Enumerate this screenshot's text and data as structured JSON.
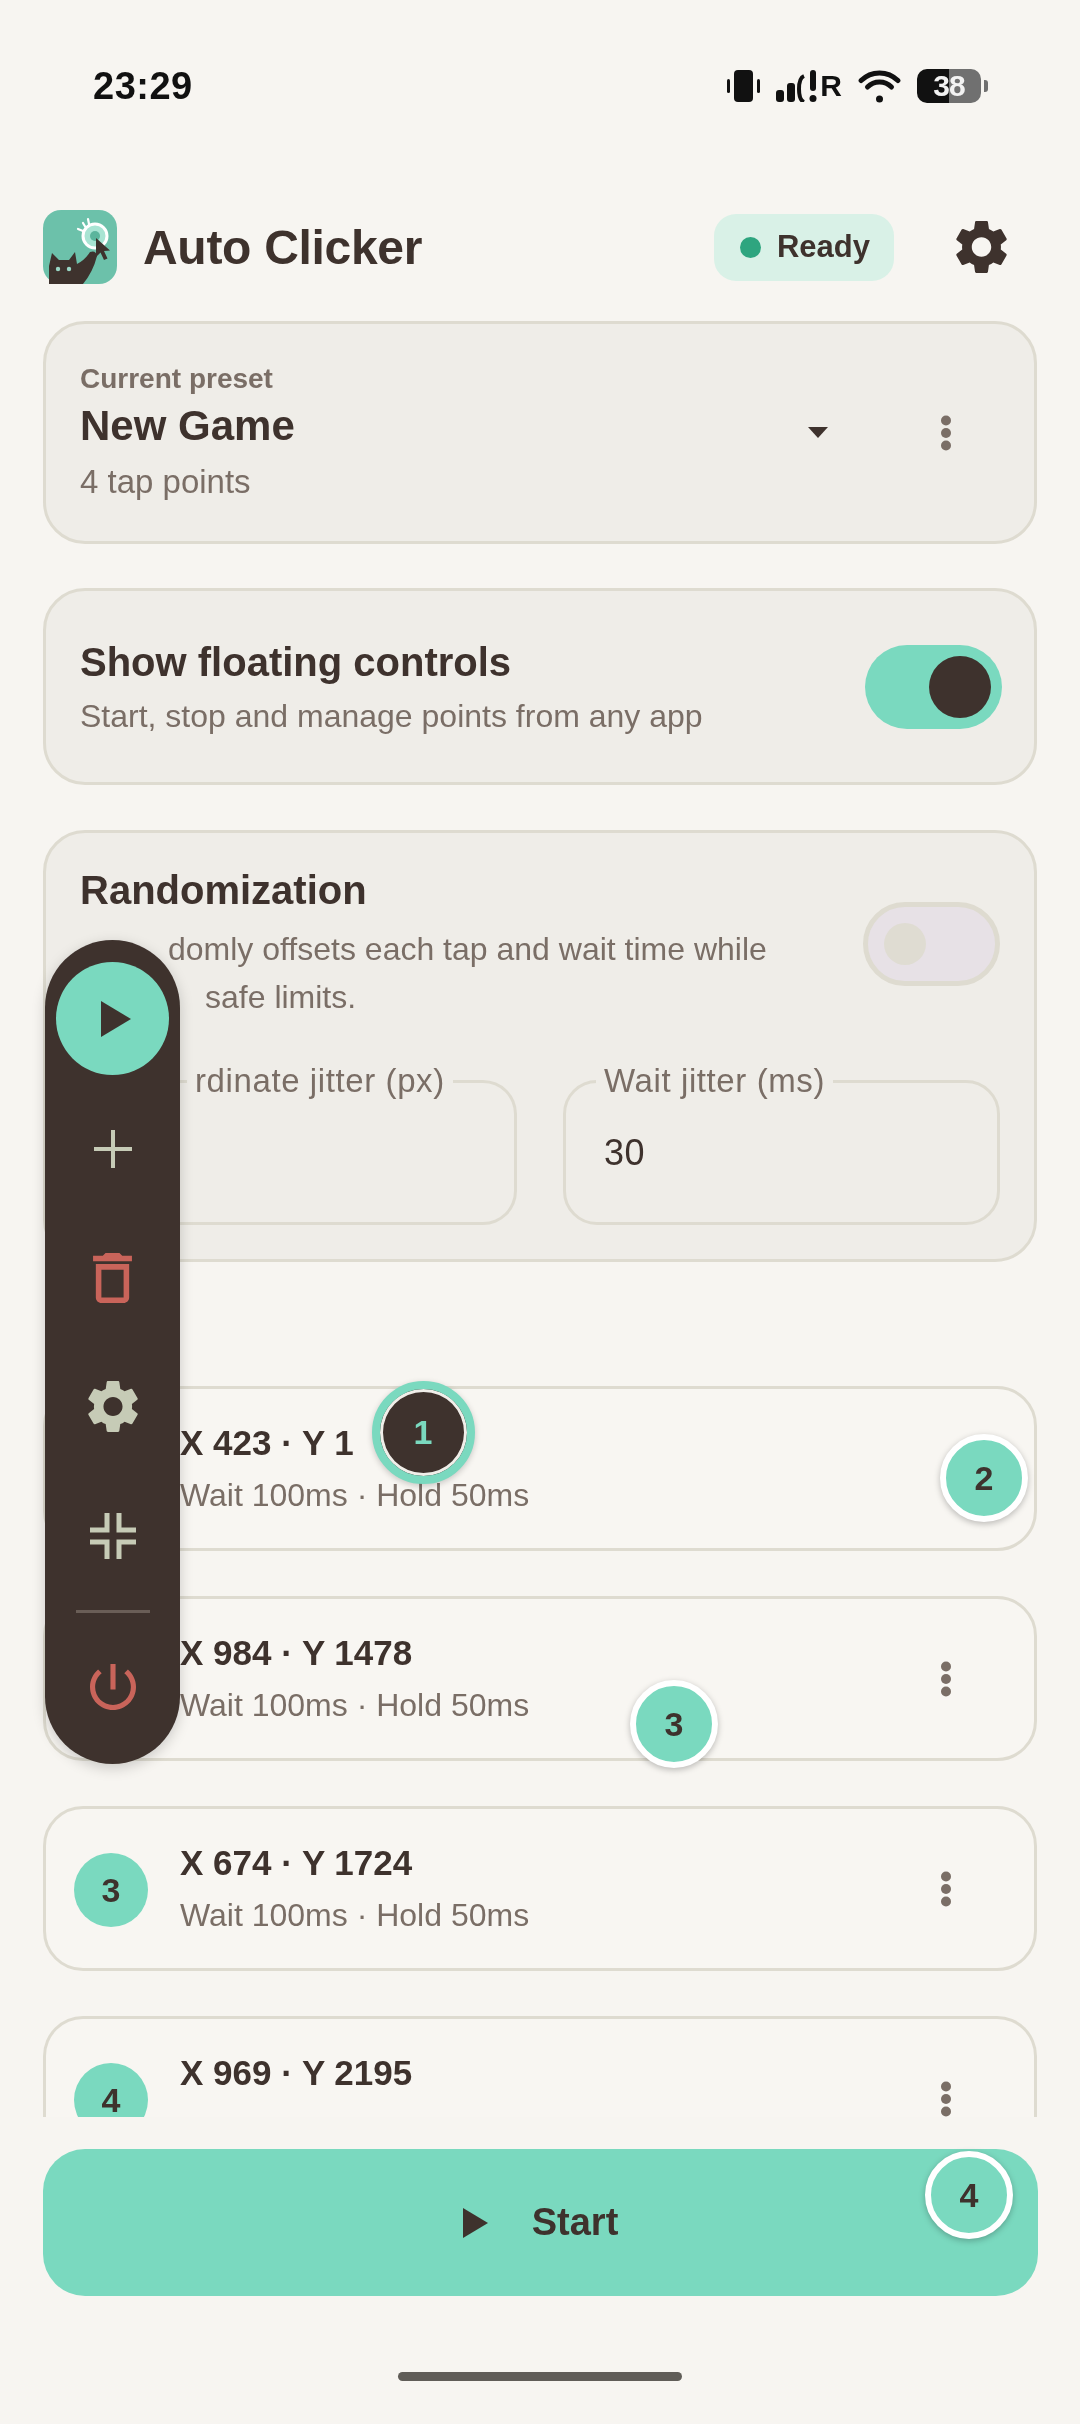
{
  "status_bar": {
    "time": "23:29",
    "signal_label": "R",
    "battery_text": "38"
  },
  "header": {
    "title": "Auto Clicker",
    "status": {
      "label": "Ready"
    }
  },
  "preset": {
    "caption": "Current preset",
    "name": "New Game",
    "summary": "4 tap points"
  },
  "floating_controls": {
    "title": "Show floating controls",
    "description": "Start, stop and manage points from any app",
    "on": true
  },
  "randomization": {
    "title": "Randomization",
    "description_lines": [
      "domly offsets each tap and wait time while",
      "safe limits."
    ],
    "on": false,
    "fields": [
      {
        "label": "rdinate jitter (px)"
      },
      {
        "label": "Wait jitter (ms)",
        "value": "30"
      }
    ]
  },
  "tap_points": [
    {
      "coords": "X 423 · Y 1",
      "timing": "Wait 100ms · Hold 50ms",
      "menu_button": false
    },
    {
      "coords": "X 984 · Y 1478",
      "timing": "Wait 100ms · Hold 50ms",
      "menu_button": true
    },
    {
      "number": "3",
      "coords": "X 674 · Y 1724",
      "timing": "Wait 100ms · Hold 50ms",
      "menu_button": true
    },
    {
      "number": "4",
      "coords": "X 969 · Y 2195",
      "menu_button": true
    }
  ],
  "floating_panel": {
    "items": [
      {
        "kind": "play"
      },
      {
        "kind": "add"
      },
      {
        "kind": "delete"
      },
      {
        "kind": "settings"
      },
      {
        "kind": "collapse"
      },
      {
        "kind": "divider"
      },
      {
        "kind": "power"
      }
    ]
  },
  "markers": [
    {
      "label": "1",
      "selected": true
    },
    {
      "label": "2",
      "selected": false
    },
    {
      "label": "3",
      "selected": false
    },
    {
      "label": "4",
      "selected": false
    }
  ],
  "start_button": {
    "label": "Start"
  }
}
